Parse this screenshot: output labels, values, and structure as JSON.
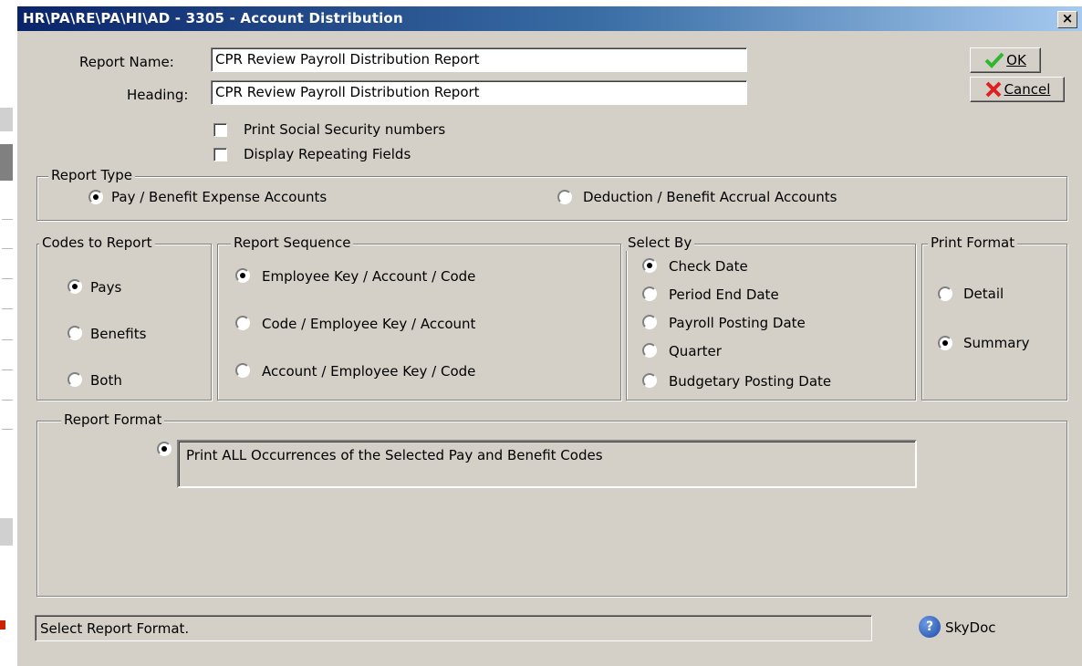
{
  "window": {
    "title": "HR\\PA\\RE\\PA\\HI\\AD - 3305 - Account Distribution",
    "close_glyph": "×"
  },
  "fields": {
    "report_name_label": "Report Name:",
    "report_name_value": "CPR Review Payroll Distribution Report",
    "heading_label": "Heading:",
    "heading_value": "CPR Review Payroll Distribution Report"
  },
  "options": {
    "print_ssn_label": "Print Social Security numbers",
    "print_ssn_checked": false,
    "display_repeating_label": "Display Repeating Fields",
    "display_repeating_checked": false
  },
  "buttons": {
    "ok_label": "OK",
    "cancel_label": "Cancel"
  },
  "report_type": {
    "legend": "Report Type",
    "options": [
      "Pay / Benefit Expense Accounts",
      "Deduction / Benefit Accrual Accounts"
    ],
    "selected": 0
  },
  "codes_to_report": {
    "legend": "Codes to Report",
    "options": [
      "Pays",
      "Benefits",
      "Both"
    ],
    "selected": 0
  },
  "report_sequence": {
    "legend": "Report Sequence",
    "options": [
      "Employee Key / Account / Code",
      "Code / Employee Key / Account",
      "Account / Employee Key / Code"
    ],
    "selected": 0
  },
  "select_by": {
    "legend": "Select By",
    "options": [
      "Check Date",
      "Period End Date",
      "Payroll Posting Date",
      "Quarter",
      "Budgetary Posting Date"
    ],
    "selected": 0
  },
  "print_format": {
    "legend": "Print Format",
    "options": [
      "Detail",
      "Summary"
    ],
    "selected": 1
  },
  "report_format": {
    "legend": "Report Format",
    "option": "Print ALL Occurrences of the Selected Pay and Benefit Codes",
    "selected": true
  },
  "status_bar": {
    "text": "Select Report Format.",
    "help_glyph": "?",
    "help_label": "SkyDoc"
  },
  "colors": {
    "title_start": "#0a246a",
    "title_end": "#a6caf0",
    "dialog_bg": "#d4d0c8",
    "ok_check": "#2fb82f",
    "cancel_x": "#e02020"
  }
}
